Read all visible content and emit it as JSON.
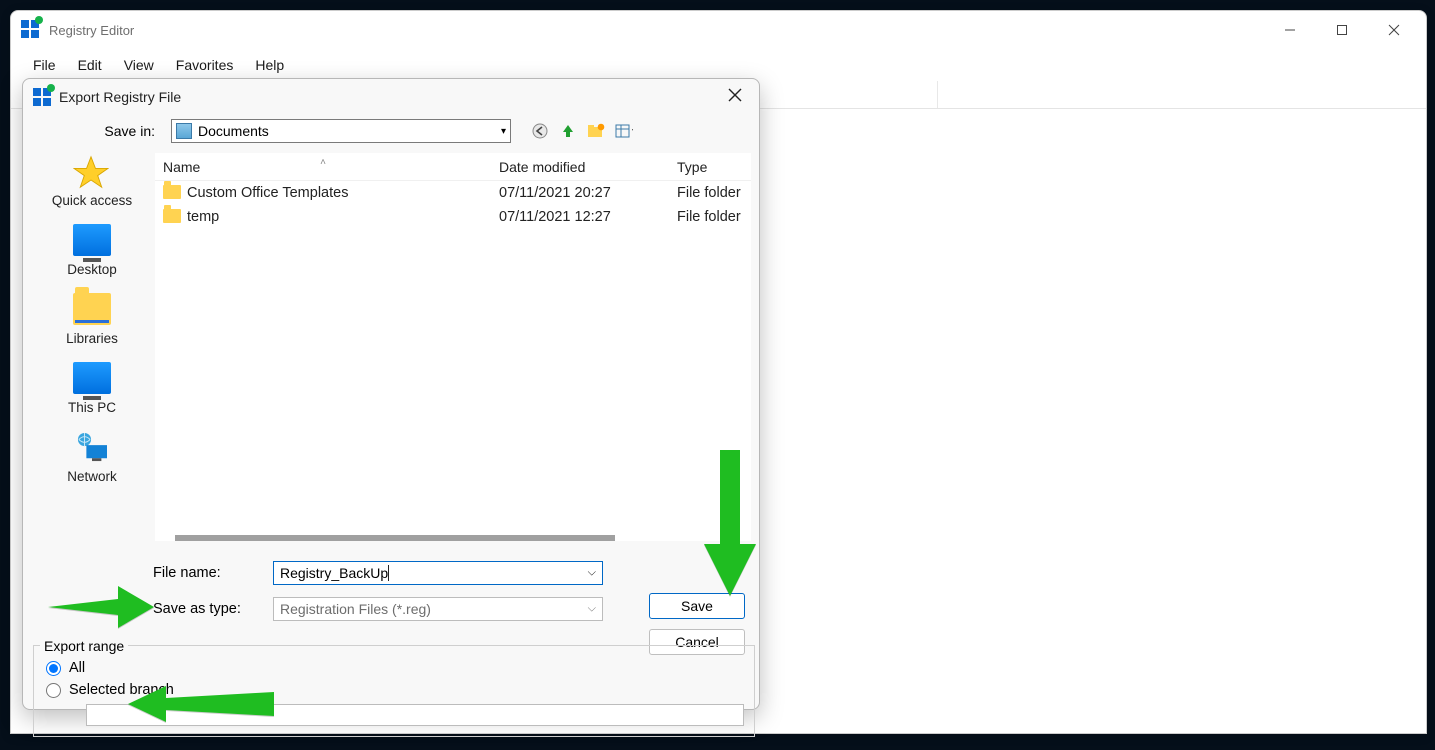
{
  "main_window": {
    "title": "Registry Editor",
    "menu": [
      "File",
      "Edit",
      "View",
      "Favorites",
      "Help"
    ]
  },
  "dialog": {
    "title": "Export Registry File",
    "save_in_label": "Save in:",
    "save_in_value": "Documents",
    "places": {
      "quick_access": "Quick access",
      "desktop": "Desktop",
      "libraries": "Libraries",
      "this_pc": "This PC",
      "network": "Network"
    },
    "columns": {
      "name": "Name",
      "date": "Date modified",
      "type": "Type"
    },
    "rows": [
      {
        "name": "Custom Office Templates",
        "date": "07/11/2021 20:27",
        "type": "File folder"
      },
      {
        "name": "temp",
        "date": "07/11/2021 12:27",
        "type": "File folder"
      }
    ],
    "file_name_label": "File name:",
    "file_name_value": "Registry_BackUp",
    "save_type_label": "Save as type:",
    "save_type_value": "Registration Files (*.reg)",
    "save_btn": "Save",
    "cancel_btn": "Cancel",
    "export_range_label": "Export range",
    "radio_all": "All",
    "radio_selected": "Selected branch"
  }
}
